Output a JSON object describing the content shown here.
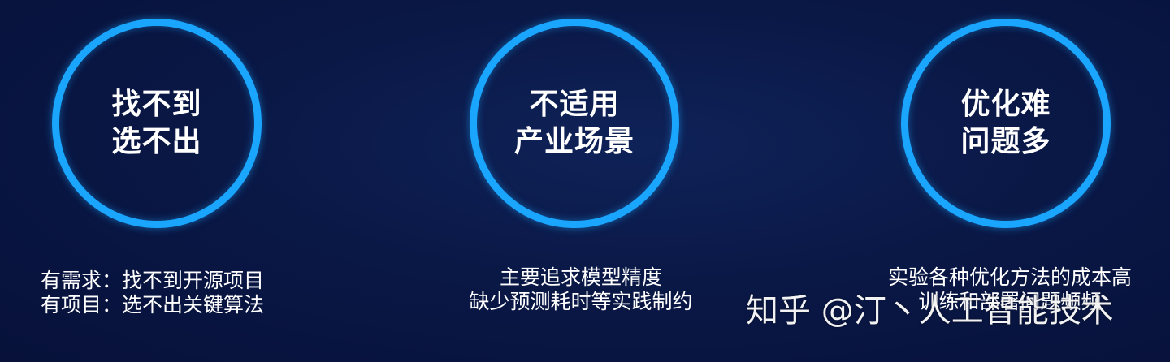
{
  "cards": [
    {
      "circle_lines": [
        "找不到",
        "选不出"
      ],
      "desc_lines": [
        "有需求：找不到开源项目",
        "有项目：选不出关键算法"
      ]
    },
    {
      "circle_lines": [
        "不适用",
        "产业场景"
      ],
      "desc_lines": [
        "主要追求模型精度",
        "缺少预测耗时等实践制约"
      ]
    },
    {
      "circle_lines": [
        "优化难",
        "问题多"
      ],
      "desc_lines": [
        "实验各种优化方法的成本高",
        "训练和部署问题频频"
      ]
    }
  ],
  "watermark": "知乎 @汀丶人工智能技术",
  "colors": {
    "ring": "#1aa6ff",
    "background": "#0a1846",
    "text": "#ffffff"
  }
}
